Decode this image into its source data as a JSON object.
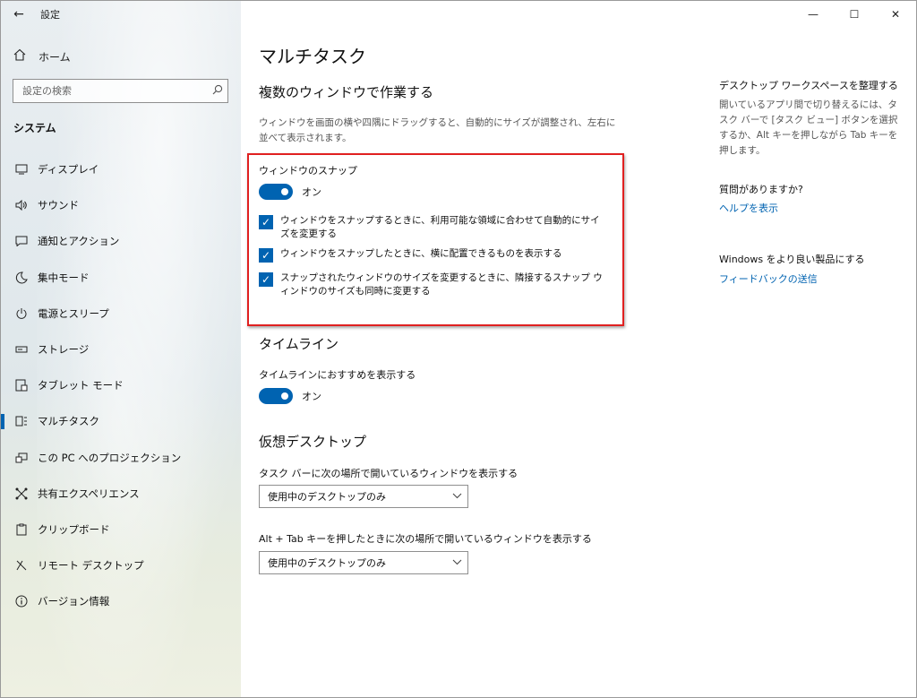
{
  "app": {
    "title": "設定"
  },
  "window_controls": {
    "minimize": "—",
    "maximize": "☐",
    "close": "✕"
  },
  "sidebar": {
    "home_label": "ホーム",
    "search_placeholder": "設定の検索",
    "section": "システム",
    "items": [
      {
        "label": "ディスプレイ",
        "icon": "display-icon"
      },
      {
        "label": "サウンド",
        "icon": "speaker-icon"
      },
      {
        "label": "通知とアクション",
        "icon": "notification-icon"
      },
      {
        "label": "集中モード",
        "icon": "moon-icon"
      },
      {
        "label": "電源とスリープ",
        "icon": "power-icon"
      },
      {
        "label": "ストレージ",
        "icon": "storage-icon"
      },
      {
        "label": "タブレット モード",
        "icon": "tablet-icon"
      },
      {
        "label": "マルチタスク",
        "icon": "multitask-icon",
        "active": true
      },
      {
        "label": "この PC へのプロジェクション",
        "icon": "projection-icon"
      },
      {
        "label": "共有エクスペリエンス",
        "icon": "share-icon"
      },
      {
        "label": "クリップボード",
        "icon": "clipboard-icon"
      },
      {
        "label": "リモート デスクトップ",
        "icon": "remote-icon"
      },
      {
        "label": "バージョン情報",
        "icon": "info-icon"
      }
    ]
  },
  "main": {
    "title": "マルチタスク",
    "multi_window": {
      "heading": "複数のウィンドウで作業する",
      "description": "ウィンドウを画面の横や四隅にドラッグすると、自動的にサイズが調整され、左右に並べて表示されます。",
      "snap_label": "ウィンドウのスナップ",
      "snap_state": "オン",
      "checks": [
        "ウィンドウをスナップするときに、利用可能な領域に合わせて自動的にサイズを変更する",
        "ウィンドウをスナップしたときに、横に配置できるものを表示する",
        "スナップされたウィンドウのサイズを変更するときに、隣接するスナップ ウィンドウのサイズも同時に変更する"
      ]
    },
    "timeline": {
      "heading": "タイムライン",
      "label": "タイムラインにおすすめを表示する",
      "state": "オン"
    },
    "virtual_desktop": {
      "heading": "仮想デスクトップ",
      "taskbar_label": "タスク バーに次の場所で開いているウィンドウを表示する",
      "taskbar_value": "使用中のデスクトップのみ",
      "alttab_label": "Alt + Tab キーを押したときに次の場所で開いているウィンドウを表示する",
      "alttab_value": "使用中のデスクトップのみ"
    }
  },
  "right_panel": {
    "workspace_heading": "デスクトップ ワークスペースを整理する",
    "workspace_text": "開いているアプリ間で切り替えるには、タスク バーで [タスク ビュー] ボタンを選択するか、Alt キーを押しながら Tab キーを押します。",
    "question_heading": "質問がありますか?",
    "help_link": "ヘルプを表示",
    "improve_heading": "Windows をより良い製品にする",
    "feedback_link": "フィードバックの送信"
  },
  "colors": {
    "accent": "#0063b1",
    "highlight": "#e02020"
  }
}
